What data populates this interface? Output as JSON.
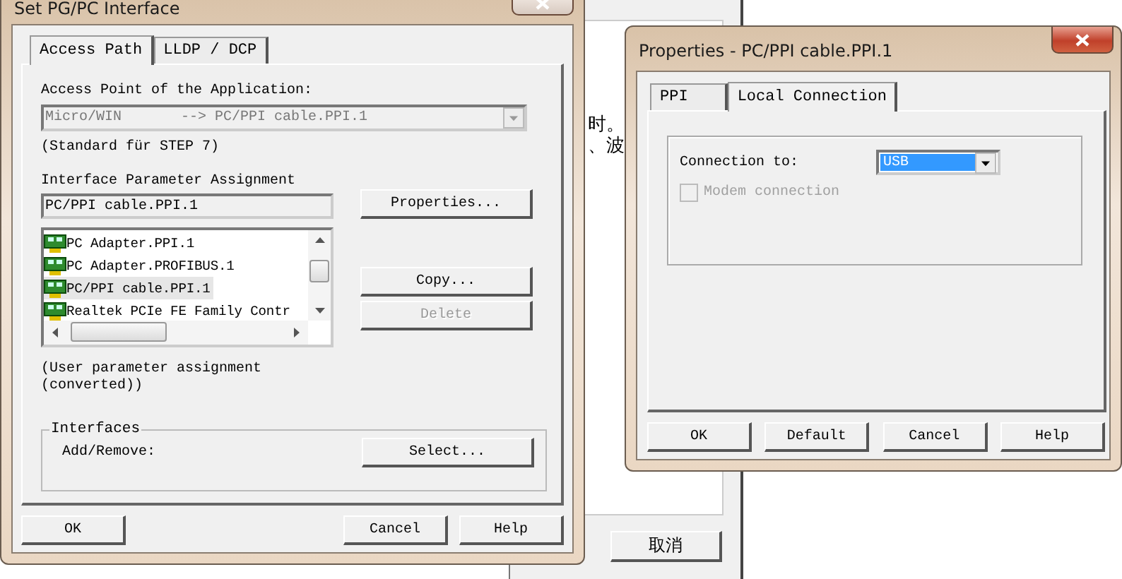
{
  "background_window": {
    "text_lines": [
      "时。",
      "、波"
    ],
    "button": "取消"
  },
  "main_dialog": {
    "title": "Set PG/PC Interface",
    "tabs": [
      {
        "label": "Access Path",
        "selected": true
      },
      {
        "label": "LLDP / DCP",
        "selected": false
      }
    ],
    "access_point": {
      "label": "Access Point of the Application:",
      "value": "Micro/WIN       --> PC/PPI cable.PPI.1",
      "disabled": true
    },
    "standard_note": "(Standard für STEP 7)",
    "assignment": {
      "label": "Interface Parameter Assignment",
      "value": "PC/PPI cable.PPI.1",
      "button": {
        "label": "Properties...",
        "disabled": false
      }
    },
    "interfaces_list": [
      {
        "label": "PC Adapter.PPI.1",
        "selected": false
      },
      {
        "label": "PC Adapter.PROFIBUS.1",
        "selected": false
      },
      {
        "label": "PC/PPI cable.PPI.1",
        "selected": true
      },
      {
        "label": "Realtek PCIe FE Family Contr",
        "selected": false
      }
    ],
    "list_buttons": [
      {
        "label": "Copy...",
        "disabled": false
      },
      {
        "label": "Delete",
        "disabled": true
      }
    ],
    "assignment_note": "(User parameter assignment\n(converted))",
    "interfaces_group": {
      "title": "Interfaces",
      "label": "Add/Remove:",
      "button": "Select..."
    },
    "footer_buttons": [
      "OK",
      "Cancel",
      "Help"
    ]
  },
  "properties_dialog": {
    "title": "Properties - PC/PPI cable.PPI.1",
    "tabs": [
      {
        "label": "PPI",
        "selected": false
      },
      {
        "label": "Local Connection",
        "selected": true
      }
    ],
    "connection_label": "Connection to:",
    "connection_value": "USB",
    "modem": {
      "label": "Modem connection",
      "checked": false,
      "disabled": true
    },
    "footer_buttons": [
      "OK",
      "Default",
      "Cancel",
      "Help"
    ]
  }
}
